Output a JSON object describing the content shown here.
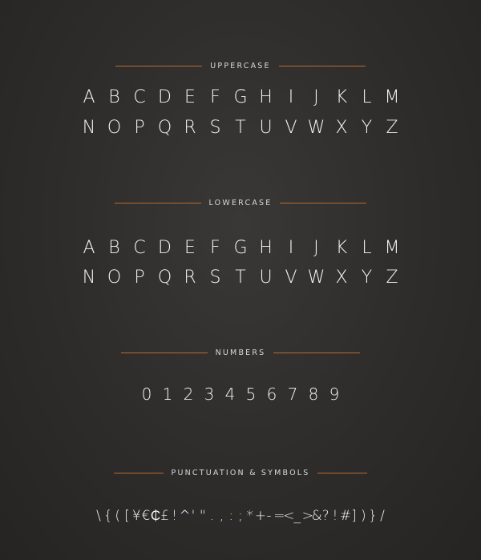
{
  "sections": {
    "uppercase": {
      "title": "UPPERCASE",
      "row1": [
        "A",
        "B",
        "C",
        "D",
        "E",
        "F",
        "G",
        "H",
        "I",
        "J",
        "K",
        "L",
        "M"
      ],
      "row2": [
        "N",
        "O",
        "P",
        "Q",
        "R",
        "S",
        "T",
        "U",
        "V",
        "W",
        "X",
        "Y",
        "Z"
      ]
    },
    "lowercase": {
      "title": "LOWERCASE",
      "row1": [
        "a",
        "b",
        "c",
        "d",
        "e",
        "f",
        "g",
        "h",
        "i",
        "j",
        "k",
        "l",
        "m"
      ],
      "row2": [
        "n",
        "o",
        "p",
        "q",
        "r",
        "s",
        "t",
        "u",
        "v",
        "w",
        "x",
        "y",
        "z"
      ]
    },
    "numbers": {
      "title": "NUMBERS",
      "row": [
        "0",
        "1",
        "2",
        "3",
        "4",
        "5",
        "6",
        "7",
        "8",
        "9"
      ]
    },
    "symbols": {
      "title": "PUNCTUATION & SYMBOLS",
      "row": [
        "\\",
        "{",
        "(",
        "[",
        "¥",
        "€",
        "₵",
        "£",
        "!",
        "^",
        "'",
        "\"",
        ".",
        ",",
        ":",
        ";",
        "*",
        "+",
        "-",
        "=",
        "<",
        "_",
        ">",
        "&",
        "?",
        "!",
        "#",
        "]",
        ")",
        "}",
        "/"
      ]
    }
  },
  "colors": {
    "background": "#2e2c2b",
    "rule": "#b86a2c",
    "glyph": "#f4f4f4",
    "heading": "#d8d8d8"
  }
}
